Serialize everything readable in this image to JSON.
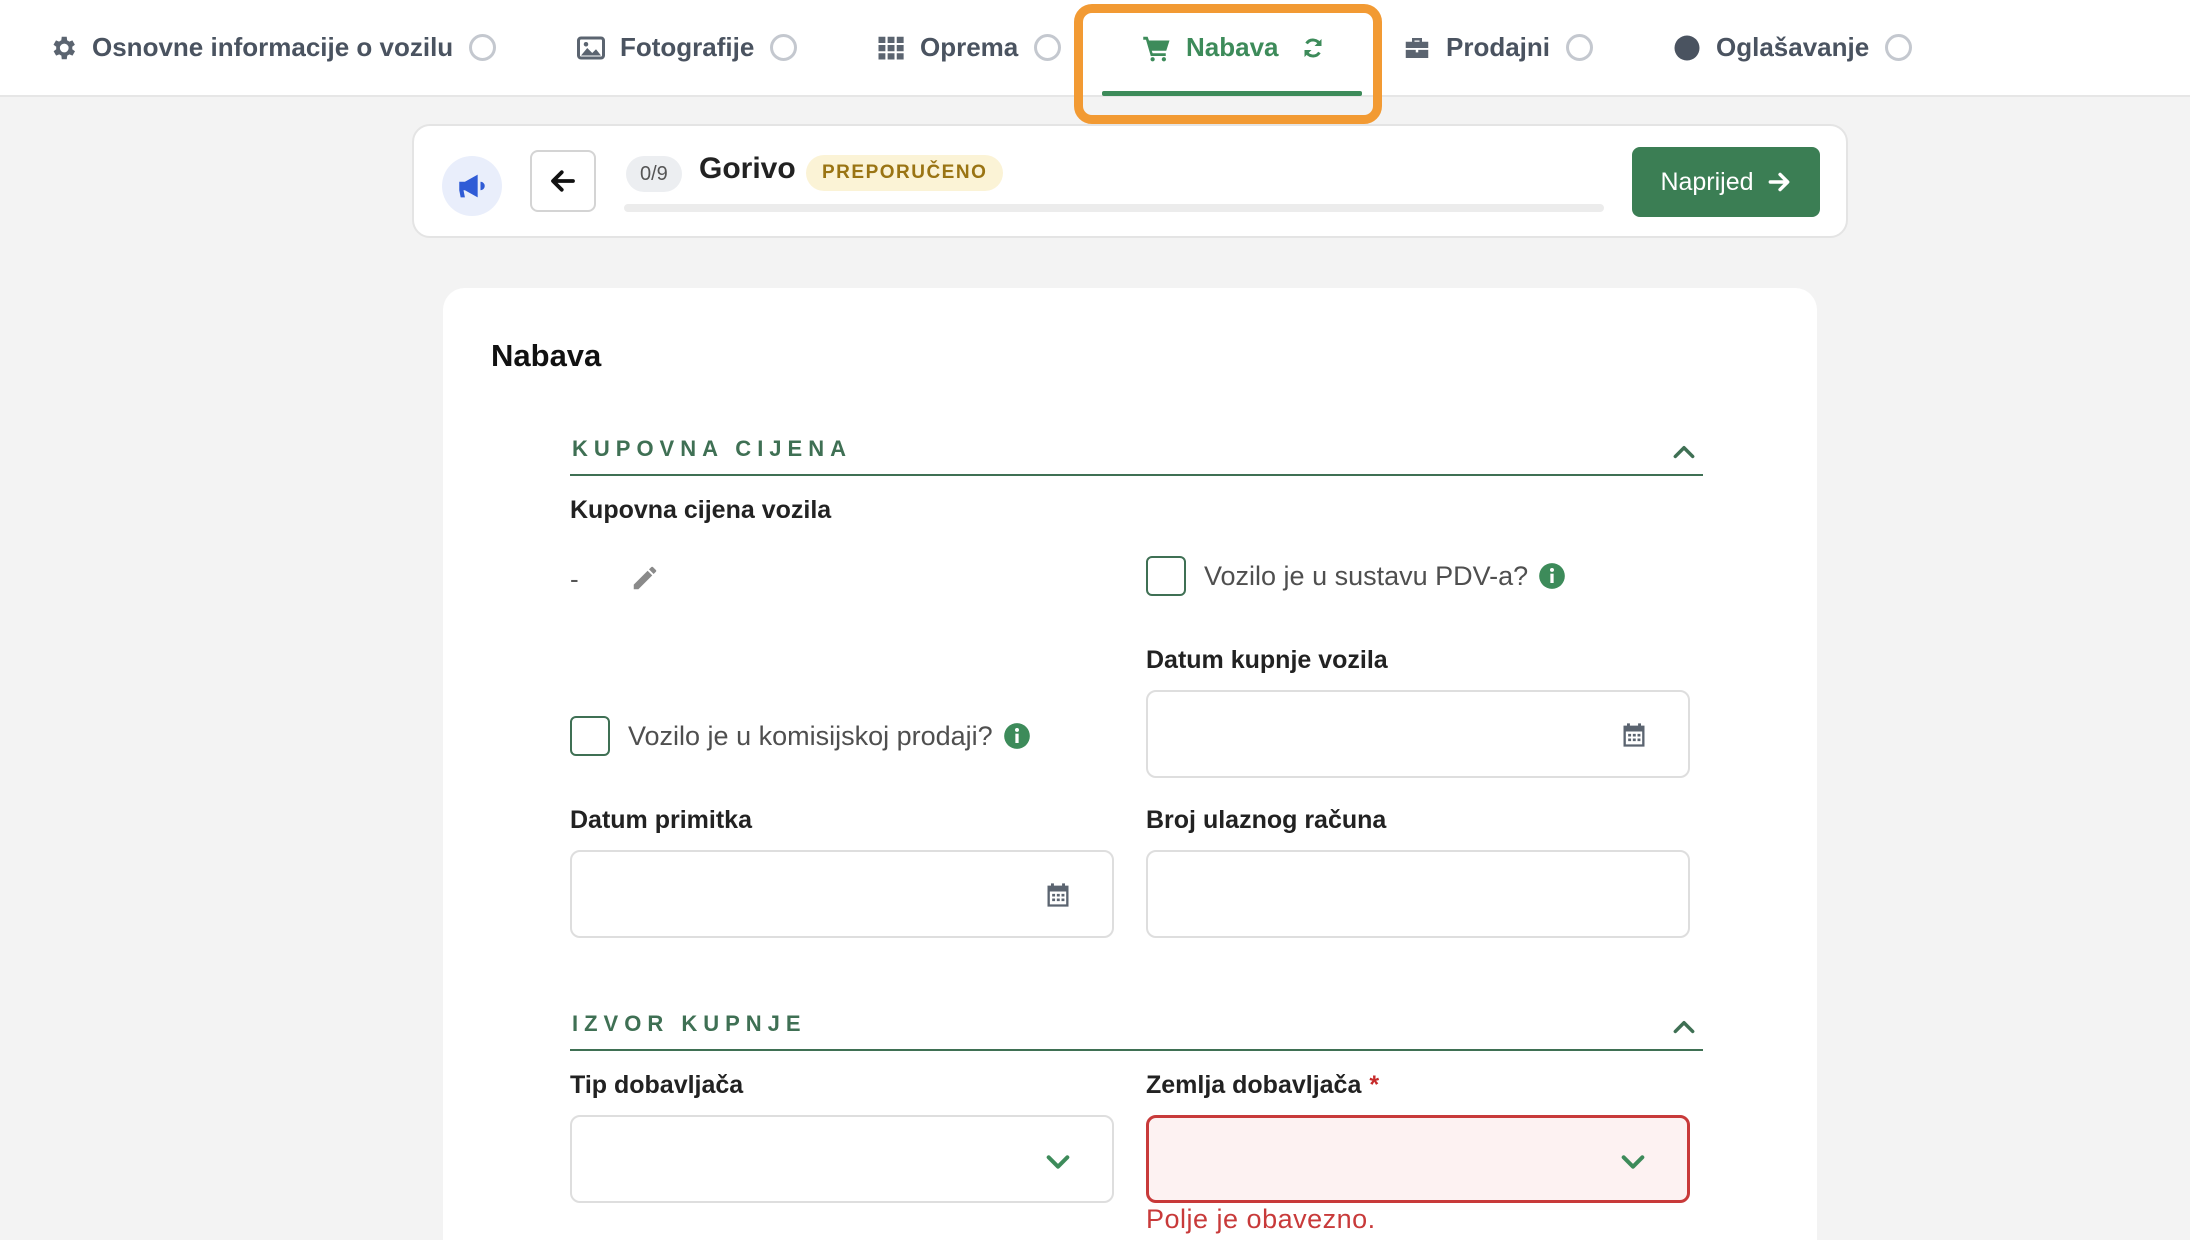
{
  "tabs": [
    {
      "label": "Osnovne informacije o vozilu",
      "icon": "gear-icon"
    },
    {
      "label": "Fotografije",
      "icon": "image-icon"
    },
    {
      "label": "Oprema",
      "icon": "grid-icon"
    },
    {
      "label": "Nabava",
      "icon": "cart-icon",
      "active": true
    },
    {
      "label": "Prodajni",
      "icon": "briefcase-icon"
    },
    {
      "label": "Oglašavanje",
      "icon": "dot-icon"
    }
  ],
  "progress": {
    "counter": "0/9",
    "current_step": "Gorivo",
    "badge": "PREPORUČENO",
    "next_label": "Naprijed"
  },
  "form": {
    "title": "Nabava",
    "sections": {
      "purchase_price": {
        "title": "KUPOVNA CIJENA",
        "price_label": "Kupovna cijena vozila",
        "price_value": "-",
        "vat_checkbox": "Vozilo je u sustavu PDV-a?",
        "commission_checkbox": "Vozilo je u komisijskoj prodaji?",
        "purchase_date_label": "Datum kupnje vozila",
        "receipt_date_label": "Datum primitka",
        "invoice_number_label": "Broj ulaznog računa"
      },
      "purchase_source": {
        "title": "IZVOR KUPNJE",
        "supplier_type_label": "Tip dobavljača",
        "supplier_country_label": "Zemlja dobavljača",
        "required_mark": "*",
        "error_message": "Polje je obavezno."
      }
    }
  },
  "colors": {
    "accent_green": "#3d8b5a",
    "primary_button": "#3b7e54",
    "highlight_orange": "#f29a33",
    "error_red": "#c83a3a",
    "badge_bg": "#fbf3d6"
  }
}
